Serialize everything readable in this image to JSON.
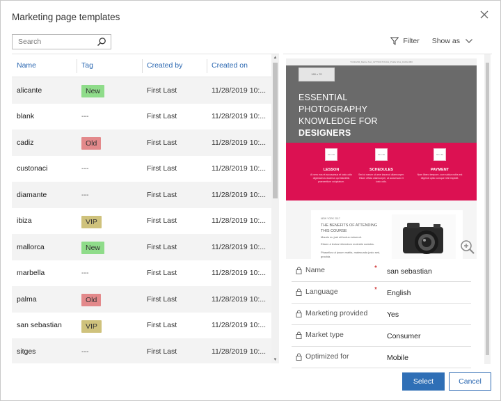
{
  "dialog": {
    "title": "Marketing page templates",
    "close_icon": "close-icon"
  },
  "search": {
    "placeholder": "Search",
    "value": ""
  },
  "toolbar": {
    "filter_label": "Filter",
    "showas_label": "Show as"
  },
  "grid": {
    "columns": [
      "Name",
      "Tag",
      "Created by",
      "Created on"
    ],
    "rows": [
      {
        "name": "alicante",
        "tag": "New",
        "created_by": "First Last",
        "created_on": "11/28/2019 10:..."
      },
      {
        "name": "blank",
        "tag": "---",
        "created_by": "First Last",
        "created_on": "11/28/2019 10:..."
      },
      {
        "name": "cadiz",
        "tag": "Old",
        "created_by": "First Last",
        "created_on": "11/28/2019 10:..."
      },
      {
        "name": "custonaci",
        "tag": "---",
        "created_by": "First Last",
        "created_on": "11/28/2019 10:..."
      },
      {
        "name": "diamante",
        "tag": "---",
        "created_by": "First Last",
        "created_on": "11/28/2019 10:..."
      },
      {
        "name": "ibiza",
        "tag": "VIP",
        "created_by": "First Last",
        "created_on": "11/28/2019 10:..."
      },
      {
        "name": "mallorca",
        "tag": "New",
        "created_by": "First Last",
        "created_on": "11/28/2019 10:..."
      },
      {
        "name": "marbella",
        "tag": "---",
        "created_by": "First Last",
        "created_on": "11/28/2019 10:..."
      },
      {
        "name": "palma",
        "tag": "Old",
        "created_by": "First Last",
        "created_on": "11/28/2019 10:..."
      },
      {
        "name": "san sebastian",
        "tag": "VIP",
        "created_by": "First Last",
        "created_on": "11/28/2019 10:..."
      },
      {
        "name": "sitges",
        "tag": "---",
        "created_by": "First Last",
        "created_on": "11/28/2019 10:..."
      }
    ]
  },
  "tag_colors": {
    "New": "#8fdc8a",
    "Old": "#e3898b",
    "VIP": "#cfc27c"
  },
  "preview": {
    "banner": "TC010284_Marine Text_InfTTO01TOUCH_Profile Shot_1920x1080",
    "placeholder": "180 x 70",
    "headline_lines": [
      "ESSENTIAL",
      "PHOTOGRAPHY",
      "KNOWLEDGE FOR"
    ],
    "headline_bold": "DESIGNERS",
    "features": [
      {
        "box": "60 x 60",
        "label": "LESSON",
        "text": "At vero eos et accusamus et iusto odio dignissimos ducimus qui blanditiis praesentium voluptatum."
      },
      {
        "box": "60 x 60",
        "label": "SCHEDULES",
        "text": "Sed ut earum ut ame lasceud ullamcorper. Etiam officia ullamcorper, at accumsan et iusto odio."
      },
      {
        "box": "60 x 60",
        "label": "PAYMENT",
        "text": "Nam libero tempore, cum soluta nobis est eligendi optio cumque nihil impedit."
      }
    ],
    "card_small": "NEW YORK 2017",
    "card_heading": "THE BENEFITS OF ATTENDING THIS COURSE",
    "card_items": [
      "Mauris eu just sit luctus euismod.",
      "Etiam ut lectus bibendum molestie sodales.",
      "Phasellus ut ipsum mattis, malesuada justo sed, gravida."
    ]
  },
  "properties": [
    {
      "label": "Name",
      "required": true,
      "value": "san sebastian"
    },
    {
      "label": "Language",
      "required": true,
      "value": "English"
    },
    {
      "label": "Marketing provided",
      "required": false,
      "value": "Yes"
    },
    {
      "label": "Market type",
      "required": false,
      "value": "Consumer"
    },
    {
      "label": "Optimized for",
      "required": false,
      "value": "Mobile"
    }
  ],
  "buttons": {
    "select": "Select",
    "cancel": "Cancel"
  },
  "colors": {
    "accent": "#2f6fb6",
    "link": "#2a67b1",
    "hero_band": "#dc1152"
  }
}
